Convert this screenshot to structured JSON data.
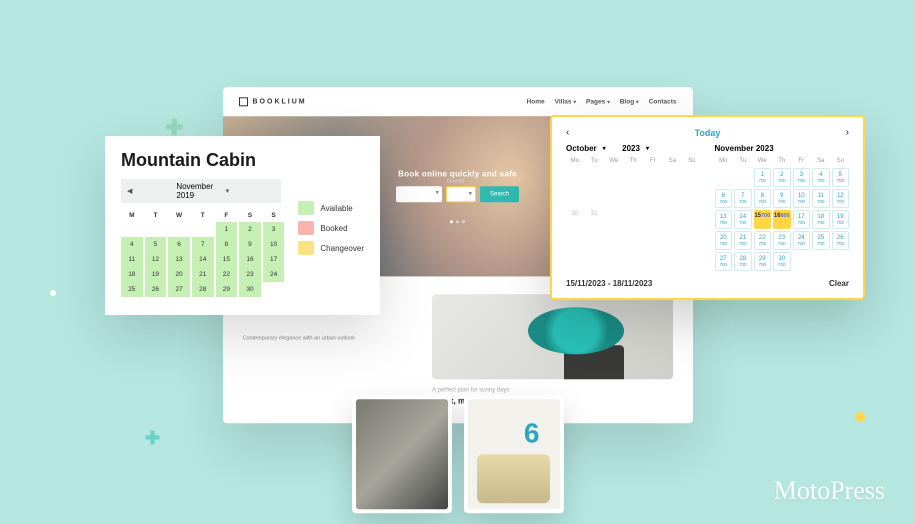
{
  "brand_logo": "MotoPress",
  "site": {
    "brand": "BOOKLIUM",
    "nav": [
      "Home",
      "Villas",
      "Pages",
      "Blog",
      "Contacts"
    ],
    "hero_title": "Book online quickly and safe",
    "hero_guests_label": "Guests",
    "hero_search": "Search",
    "body_caption": "Contemporary elegance with an urban outlook",
    "section_caption": "A perfect plan for sunny days",
    "section_headline": "Relax, make new friends, enjoy"
  },
  "left": {
    "title": "Mountain Cabin",
    "month_label": "November 2019",
    "weekdays": [
      "M",
      "T",
      "W",
      "T",
      "F",
      "S",
      "S"
    ],
    "rows": [
      [
        "",
        "",
        "",
        "",
        "1",
        "2",
        "3"
      ],
      [
        "4",
        "5",
        "6",
        "7",
        "8",
        "9",
        "10"
      ],
      [
        "11",
        "12",
        "13",
        "14",
        "15",
        "16",
        "17"
      ],
      [
        "18",
        "19",
        "20",
        "21",
        "22",
        "23",
        "24"
      ],
      [
        "25",
        "26",
        "27",
        "28",
        "29",
        "30",
        ""
      ]
    ],
    "legend": {
      "available": "Available",
      "booked": "Booked",
      "changeover": "Changeover"
    }
  },
  "right": {
    "today": "Today",
    "month1": "October",
    "year1": "2023",
    "month2": "November 2023",
    "weekdays": [
      "Mo",
      "Tu",
      "We",
      "Th",
      "Fr",
      "Sa",
      "Su"
    ],
    "oct_days": [
      [
        "",
        "",
        "",
        "",
        "",
        "",
        ""
      ],
      [
        "",
        "",
        "",
        "",
        "",
        "",
        ""
      ],
      [
        "",
        "",
        "",
        "",
        "",
        "",
        ""
      ],
      [
        "",
        "",
        "",
        "",
        "",
        "",
        ""
      ],
      [
        "",
        "",
        "",
        "",
        "",
        "",
        ""
      ],
      [
        "30",
        "31",
        "",
        "",
        "",
        "",
        ""
      ]
    ],
    "nov": {
      "days": [
        [
          "",
          "",
          "1",
          "2",
          "3",
          "4",
          "5"
        ],
        [
          "6",
          "7",
          "8",
          "9",
          "10",
          "11",
          "12"
        ],
        [
          "13",
          "14",
          "15",
          "16",
          "17",
          "18",
          "19"
        ],
        [
          "20",
          "21",
          "22",
          "23",
          "24",
          "25",
          "26"
        ],
        [
          "27",
          "28",
          "29",
          "30",
          "",
          "",
          ""
        ]
      ],
      "highlight": {
        "15": "700",
        "16": "800"
      }
    },
    "range_label": "15/11/2023 - 18/11/2023",
    "clear": "Clear",
    "price_label": "700"
  }
}
